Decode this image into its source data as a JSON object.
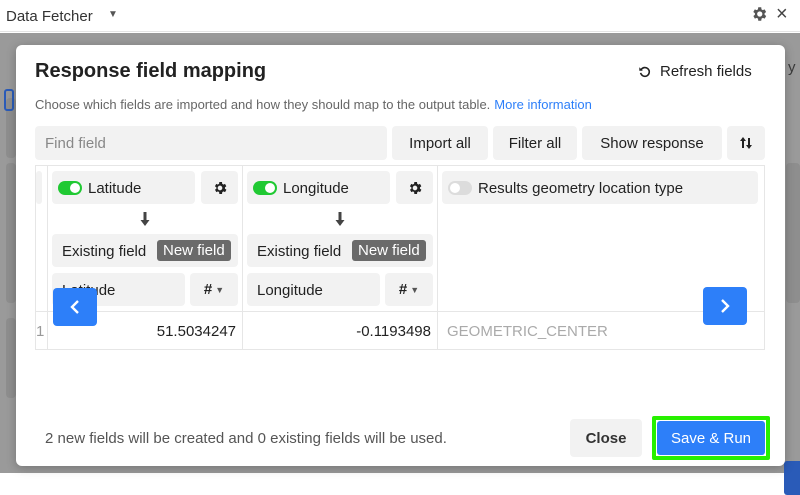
{
  "app": {
    "title": "Data Fetcher"
  },
  "background": {
    "right_text": "y"
  },
  "modal": {
    "title": "Response field mapping",
    "refresh_label": "Refresh fields",
    "description": "Choose which fields are imported and how they should map to the output table.",
    "more_info_link": "More information",
    "find_placeholder": "Find field",
    "toolbar": {
      "import_all": "Import all",
      "filter_all": "Filter all",
      "show_response": "Show response"
    },
    "columns": [
      {
        "name": "Latitude",
        "enabled": true,
        "existing_label": "Existing field",
        "new_label": "New field",
        "field_name": "Latitude",
        "type_icon": "#"
      },
      {
        "name": "Longitude",
        "enabled": true,
        "existing_label": "Existing field",
        "new_label": "New field",
        "field_name": "Longitude",
        "type_icon": "#"
      },
      {
        "name": "Results geometry location type",
        "enabled": false
      }
    ],
    "row": {
      "index": "1",
      "values": [
        "51.5034247",
        "-0.1193498",
        "GEOMETRIC_CENTER"
      ]
    },
    "footer_text": "2 new fields will be created and 0 existing fields will be used.",
    "close_label": "Close",
    "save_run_label": "Save & Run"
  },
  "colors": {
    "accent": "#2d7ff9",
    "toggle_on": "#20c933",
    "highlight": "#27f000"
  }
}
